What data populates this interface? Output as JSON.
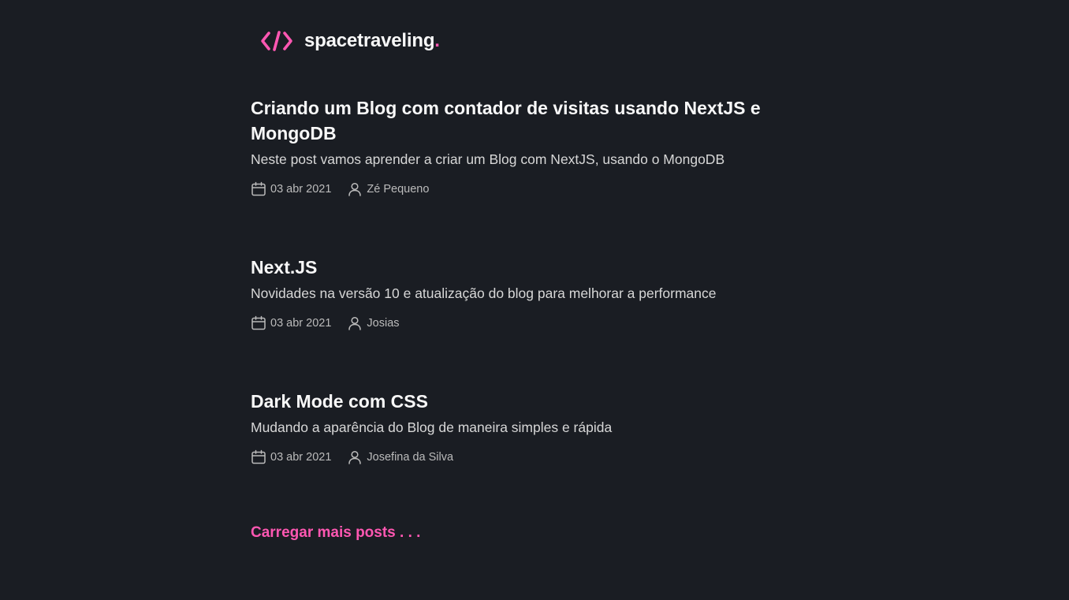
{
  "brand": {
    "name": "spacetraveling",
    "dot": ".",
    "logo_icon": "code-icon",
    "accent_color": "#FF57B2"
  },
  "posts": [
    {
      "title": "Criando um Blog com contador de visitas usando NextJS e MongoDB",
      "subtitle": "Neste post vamos aprender a criar um Blog com NextJS, usando o MongoDB",
      "date": "03 abr 2021",
      "author": "Zé Pequeno"
    },
    {
      "title": "Next.JS",
      "subtitle": "Novidades na versão 10 e atualização do blog para melhorar a performance",
      "date": "03 abr 2021",
      "author": "Josias"
    },
    {
      "title": "Dark Mode com CSS",
      "subtitle": "Mudando a aparência do Blog de maneira simples e rápida",
      "date": "03 abr 2021",
      "author": "Josefina da Silva"
    }
  ],
  "load_more_label": "Carregar mais posts . . .",
  "icons": {
    "date": "calendar-icon",
    "author": "user-icon"
  },
  "colors": {
    "background": "#1A1D23",
    "heading": "#F8F8F8",
    "body": "#D7D7D7",
    "meta": "#BBBBBB"
  }
}
